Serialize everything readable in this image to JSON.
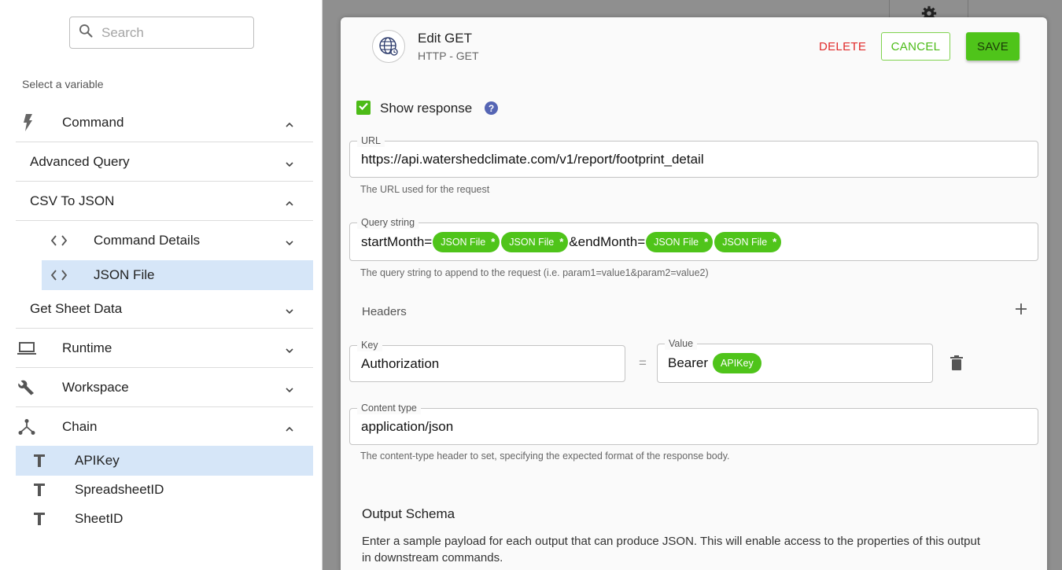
{
  "sidebar": {
    "search_placeholder": "Search",
    "select_label": "Select a variable",
    "items": [
      {
        "label": "Command",
        "icon": "lightning-icon",
        "expanded": true
      },
      {
        "label": "Advanced Query",
        "expanded": false
      },
      {
        "label": "CSV To JSON",
        "expanded": true
      },
      {
        "label": "Command Details",
        "icon": "code-icon",
        "expanded": false
      },
      {
        "label": "JSON File",
        "icon": "code-icon",
        "selected": true
      },
      {
        "label": "Get Sheet Data",
        "expanded": false
      },
      {
        "label": "Runtime",
        "icon": "laptop-icon",
        "expanded": false
      },
      {
        "label": "Workspace",
        "icon": "wrench-icon",
        "expanded": false
      },
      {
        "label": "Chain",
        "icon": "fork-icon",
        "expanded": true
      },
      {
        "label": "APIKey",
        "icon": "text-type-icon",
        "selected": true
      },
      {
        "label": "SpreadsheetID",
        "icon": "text-type-icon"
      },
      {
        "label": "SheetID",
        "icon": "text-type-icon"
      }
    ]
  },
  "dialog": {
    "title": "Edit GET",
    "subtitle": "HTTP - GET",
    "delete_label": "DELETE",
    "cancel_label": "CANCEL",
    "save_label": "SAVE",
    "show_response_label": "Show response",
    "show_response_checked": true,
    "help_glyph": "?",
    "url": {
      "label": "URL",
      "value": "https://api.watershedclimate.com/v1/report/footprint_detail",
      "hint": "The URL used for the request"
    },
    "query": {
      "label": "Query string",
      "text1": "startMonth=",
      "chip1": "JSON File",
      "chip2": "JSON File",
      "text2": "&endMonth=",
      "chip3": "JSON File",
      "chip4": "JSON File",
      "chip_star": "*",
      "hint": "The query string to append to the request (i.e. param1=value1&param2=value2)"
    },
    "headers": {
      "label": "Headers",
      "key_label": "Key",
      "key_value": "Authorization",
      "equals": "=",
      "value_label": "Value",
      "value_text": "Bearer",
      "value_chip": "APIKey"
    },
    "content_type": {
      "label": "Content type",
      "value": "application/json",
      "hint": "The content-type header to set, specifying the expected format of the response body."
    },
    "output_schema": {
      "title": "Output Schema",
      "description": "Enter a sample payload for each output that can produce JSON. This will enable access to the properties of this output in downstream commands."
    }
  },
  "colors": {
    "accent_green": "#4fc41a",
    "delete_red": "#e12b2b",
    "selected_bg": "#d6e6f8",
    "help_blue": "#5565b4"
  }
}
